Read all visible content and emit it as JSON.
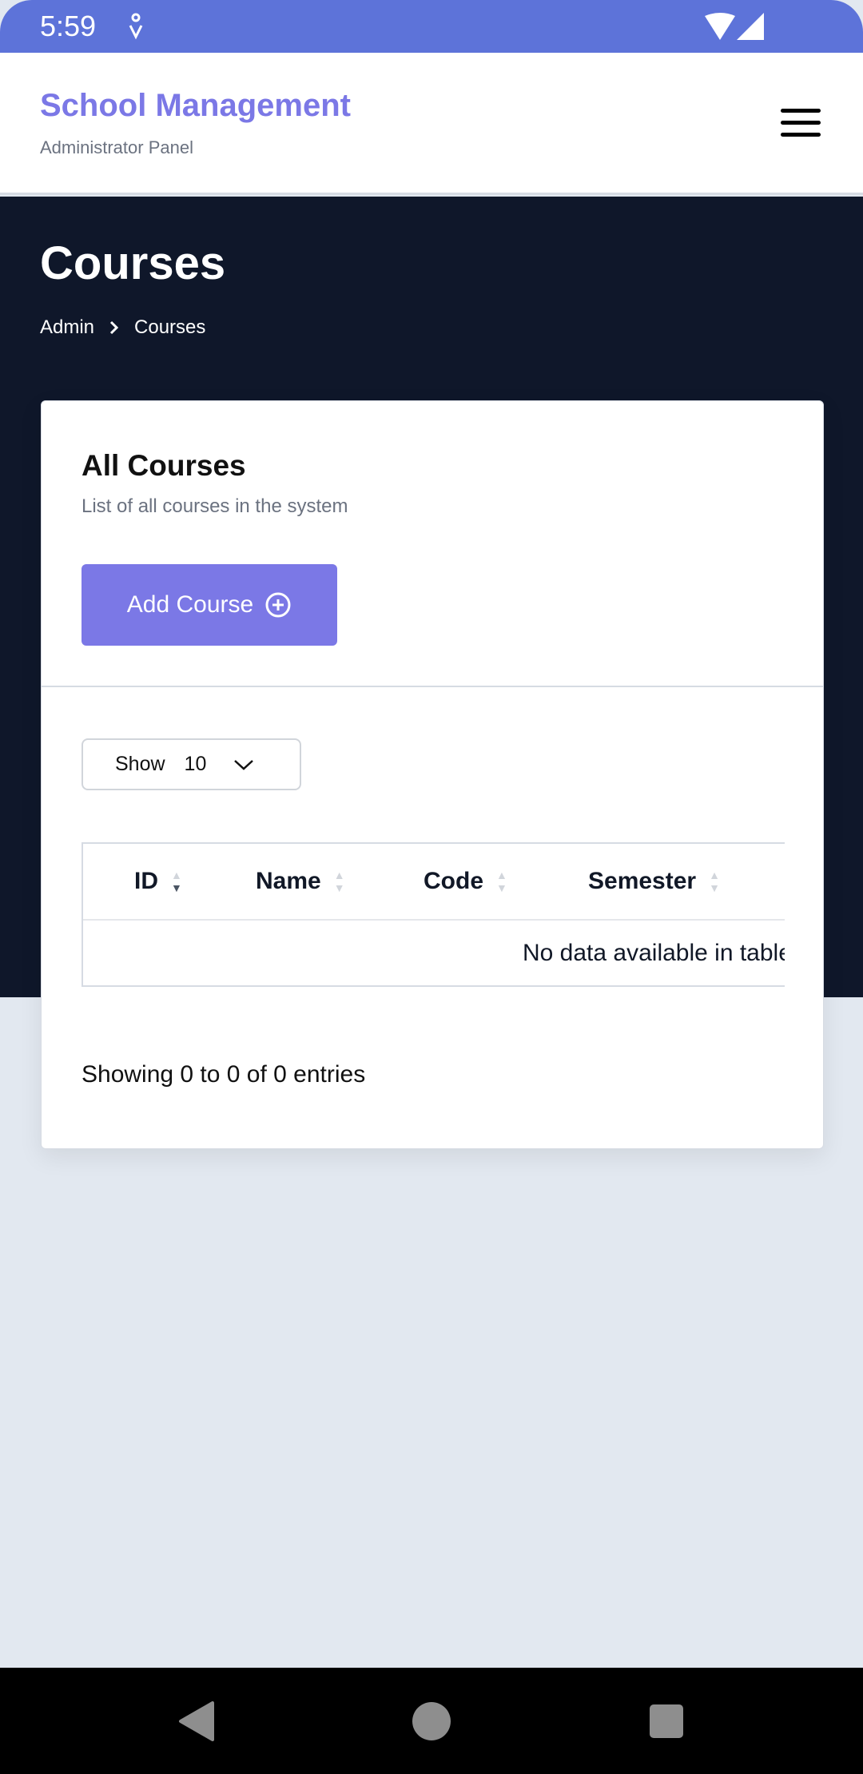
{
  "status_bar": {
    "time": "5:59"
  },
  "header": {
    "title": "School Management",
    "subtitle": "Administrator Panel"
  },
  "hero": {
    "title": "Courses",
    "breadcrumb": [
      "Admin",
      "Courses"
    ]
  },
  "card": {
    "title": "All Courses",
    "description": "List of all courses in the system",
    "add_button": "Add Course",
    "show_label": "Show",
    "show_value": "10",
    "columns": [
      "ID",
      "Name",
      "Code",
      "Semester"
    ],
    "empty_text": "No data available in table",
    "entries_info": "Showing 0 to 0 of 0 entries"
  },
  "colors": {
    "accent": "#7b78e6",
    "status_bar": "#5d73d9",
    "hero_bg": "#0f172a",
    "page_bg": "#e2e8f0"
  }
}
